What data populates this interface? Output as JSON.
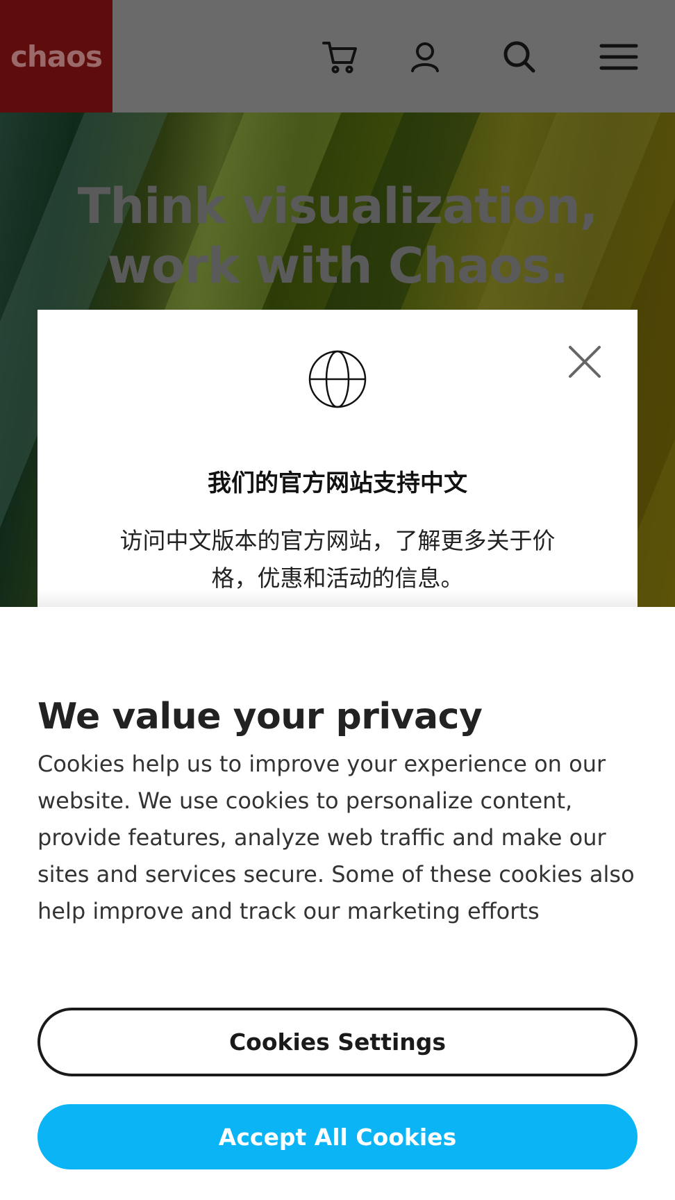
{
  "header": {
    "logo_text": "chaos",
    "icons": [
      "cart-icon",
      "user-icon",
      "search-icon",
      "menu-icon"
    ]
  },
  "hero": {
    "title_line1": "Think visualization,",
    "title_line2": "work with Chaos."
  },
  "language_modal": {
    "title": "我们的官方网站支持中文",
    "description": "访问中文版本的官方网站，了解更多关于价格，优惠和活动的信息。"
  },
  "cookie_banner": {
    "title": "We value your privacy",
    "description": "Cookies help us to improve your experience on our website. We use cookies to personalize content, provide features, analyze web traffic and make our sites and services secure. Some of these cookies also help improve and track our marketing efforts",
    "settings_label": "Cookies Settings",
    "accept_label": "Accept All Cookies"
  },
  "colors": {
    "header_bg": "#6a6a6a",
    "logo_bg": "#5e0c0c",
    "accept_button": "#0ab4f5"
  }
}
